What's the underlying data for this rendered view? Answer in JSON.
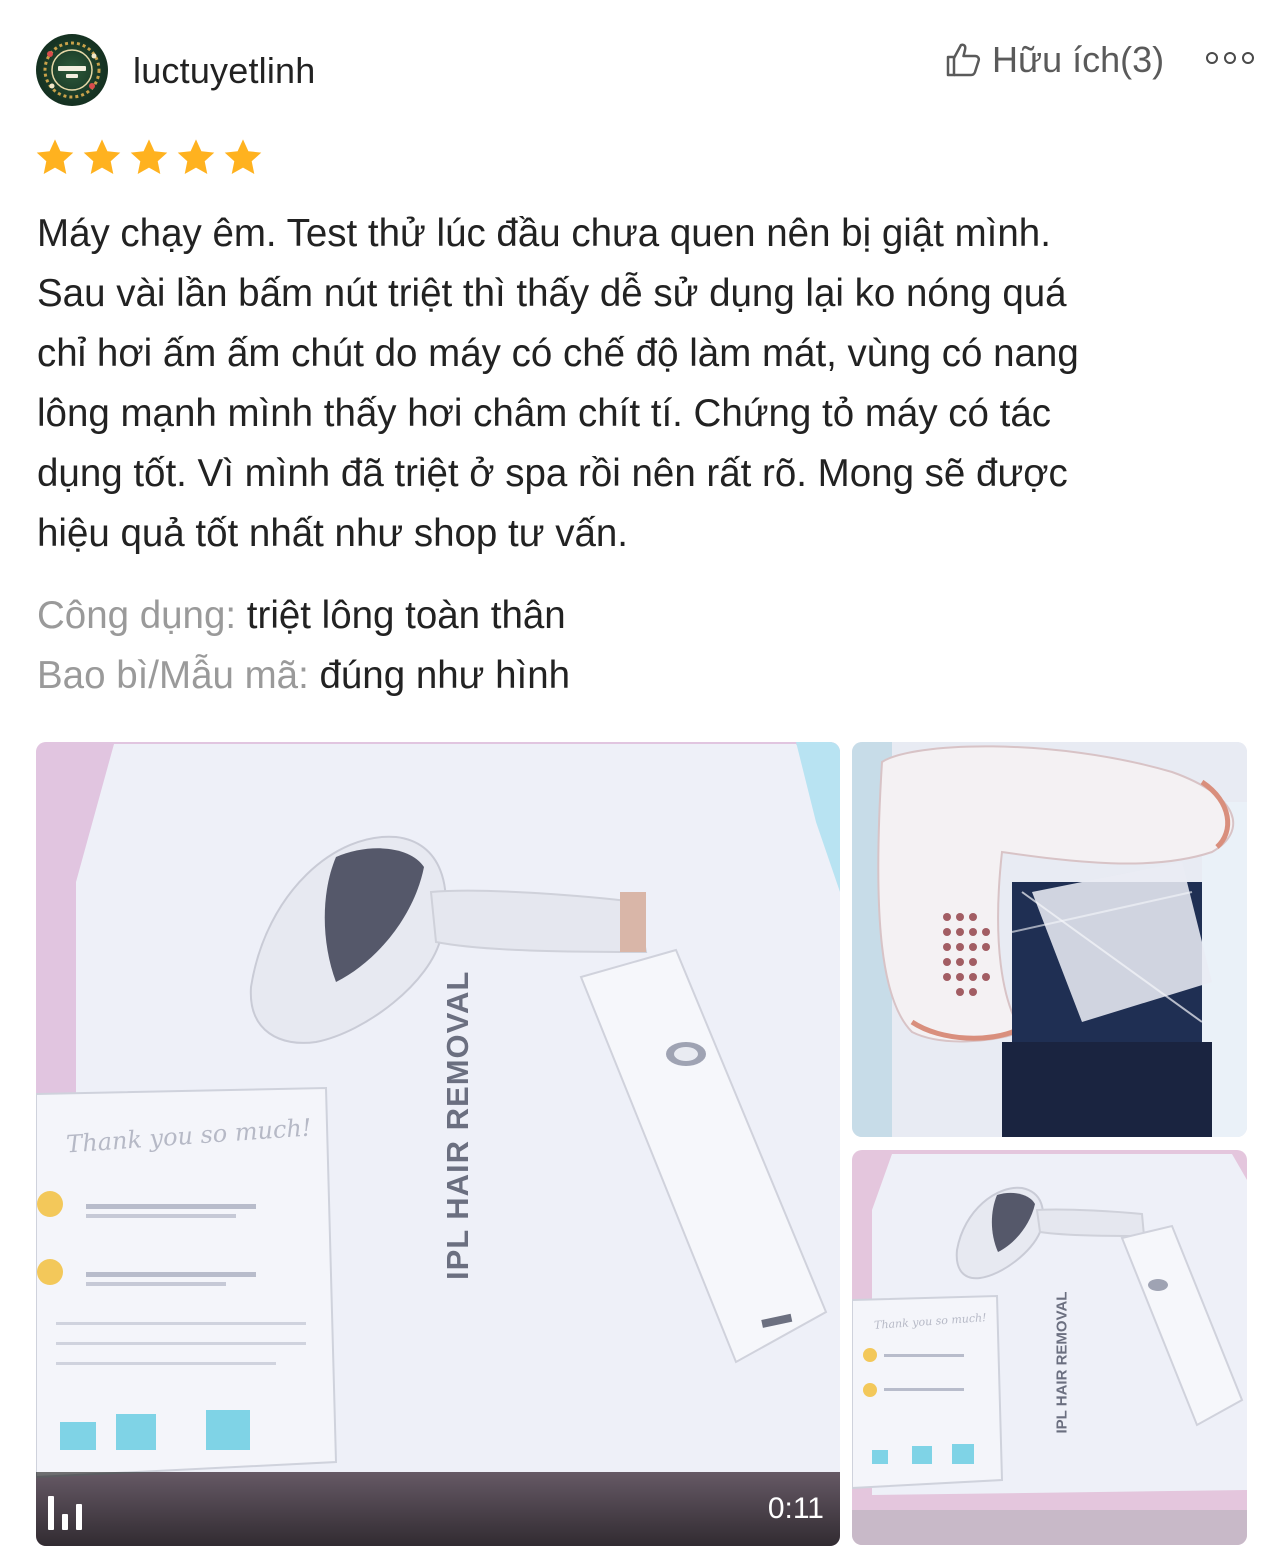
{
  "review": {
    "username": "luctuyetlinh",
    "helpful_label": "Hữu ích(3)",
    "rating": 5,
    "colors": {
      "star": "#ffb21f",
      "muted": "#9a9a9a",
      "text": "#222222"
    },
    "body_lines": [
      "Máy chạy êm. Test thử lúc đầu chưa quen nên bị giật mình.",
      "Sau vài lần bấm nút triệt thì thấy dễ sử dụng lại ko nóng quá",
      "chỉ hơi ấm ấm chút do máy có chế độ làm mát, vùng có nang",
      "lông mạnh mình thấy hơi châm chít tí. Chứng tỏ máy có tác",
      "dụng tốt. Vì mình đã triệt ở spa rồi nên rất rõ. Mong sẽ được",
      "hiệu quả tốt nhất như shop tư vấn."
    ],
    "attributes": [
      {
        "key": "Công dụng:",
        "value": "triệt lông toàn thân"
      },
      {
        "key": "Bao bì/Mẫu mã:",
        "value": "đúng như hình"
      }
    ],
    "media": {
      "video_duration": "0:11",
      "product_label": "IPL HAIR REMOVAL",
      "card_heading": "Thank you so much!"
    }
  }
}
